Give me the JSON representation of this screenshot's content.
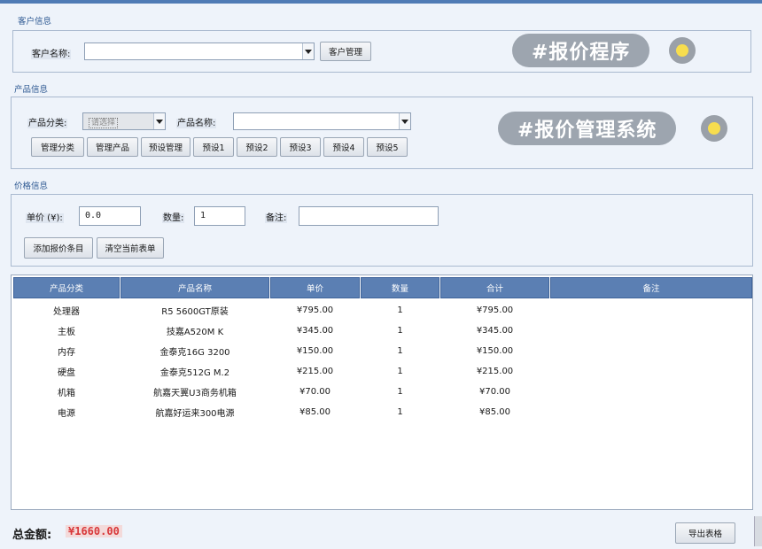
{
  "customer": {
    "section_title": "客户信息",
    "name_label": "客户名称:",
    "name_value": "",
    "manage_button": "客户管理"
  },
  "product": {
    "section_title": "产品信息",
    "category_label": "产品分类:",
    "category_value": "请选择",
    "name_label": "产品名称:",
    "name_value": "",
    "buttons": [
      "管理分类",
      "管理产品",
      "预设管理",
      "预设1",
      "预设2",
      "预设3",
      "预设4",
      "预设5"
    ]
  },
  "price": {
    "section_title": "价格信息",
    "unit_price_label": "单价 (¥):",
    "unit_price_value": "0.0",
    "quantity_label": "数量:",
    "quantity_value": "1",
    "note_label": "备注:",
    "note_value": "",
    "add_button": "添加报价条目",
    "clear_button": "清空当前表单"
  },
  "overlays": {
    "tag1": "#报价程序",
    "tag2": "#报价管理系统"
  },
  "table": {
    "headers": [
      "产品分类",
      "产品名称",
      "单价",
      "数量",
      "合计",
      "备注"
    ],
    "rows": [
      [
        "处理器",
        "R5 5600GT原装",
        "¥795.00",
        "1",
        "¥795.00",
        ""
      ],
      [
        "主板",
        "技嘉A520M K",
        "¥345.00",
        "1",
        "¥345.00",
        ""
      ],
      [
        "内存",
        "金泰克16G 3200",
        "¥150.00",
        "1",
        "¥150.00",
        ""
      ],
      [
        "硬盘",
        "金泰克512G M.2",
        "¥215.00",
        "1",
        "¥215.00",
        ""
      ],
      [
        "机箱",
        "航嘉天翼U3商务机箱",
        "¥70.00",
        "1",
        "¥70.00",
        ""
      ],
      [
        "电源",
        "航嘉好运来300电源",
        "¥85.00",
        "1",
        "¥85.00",
        ""
      ]
    ]
  },
  "footer": {
    "total_label": "总金额:",
    "total_value": "¥1660.00",
    "export_button": "导出表格"
  },
  "colors": {
    "accent": "#5b7fb3",
    "total_red": "#d8383a",
    "background": "#eef3fa"
  }
}
